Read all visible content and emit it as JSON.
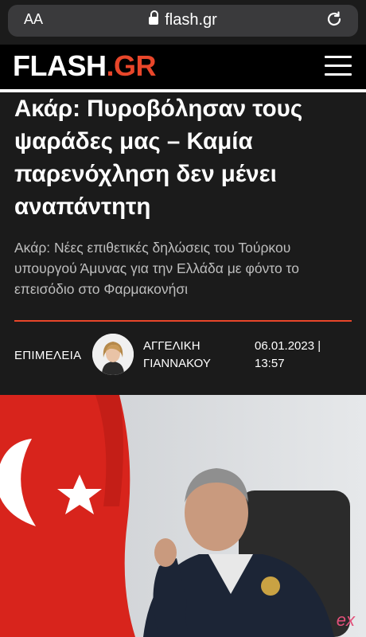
{
  "browser": {
    "aa_label": "AA",
    "url": "flash.gr"
  },
  "site": {
    "logo_main": "FLASH",
    "logo_dot": ".",
    "logo_tld": "GR",
    "accent_color": "#e8462a"
  },
  "article": {
    "headline": "Ακάρ: Πυροβόλησαν τους ψαράδες μας – Καμία παρενόχληση δεν μένει αναπάντητη",
    "subtitle": "Ακάρ: Νέες επιθετικές δηλώσεις του Τούρκου υπουργού Άμυνας για την Ελλάδα με φόντο το επεισόδιο στο Φαρμακονήσι",
    "byline_label": "ΕΠΙΜΕΛΕΙΑ",
    "author_first": "ΑΓΓΕΛΙΚΗ",
    "author_last": "ΓΙΑΝΝΑΚΟΥ",
    "date_line1": "06.01.2023 |",
    "date_line2": "13:57"
  },
  "photo": {
    "watermark": "ex"
  },
  "icons": {
    "lock": "lock-icon",
    "reload": "reload-icon",
    "menu": "hamburger-menu-icon",
    "avatar": "author-avatar"
  }
}
